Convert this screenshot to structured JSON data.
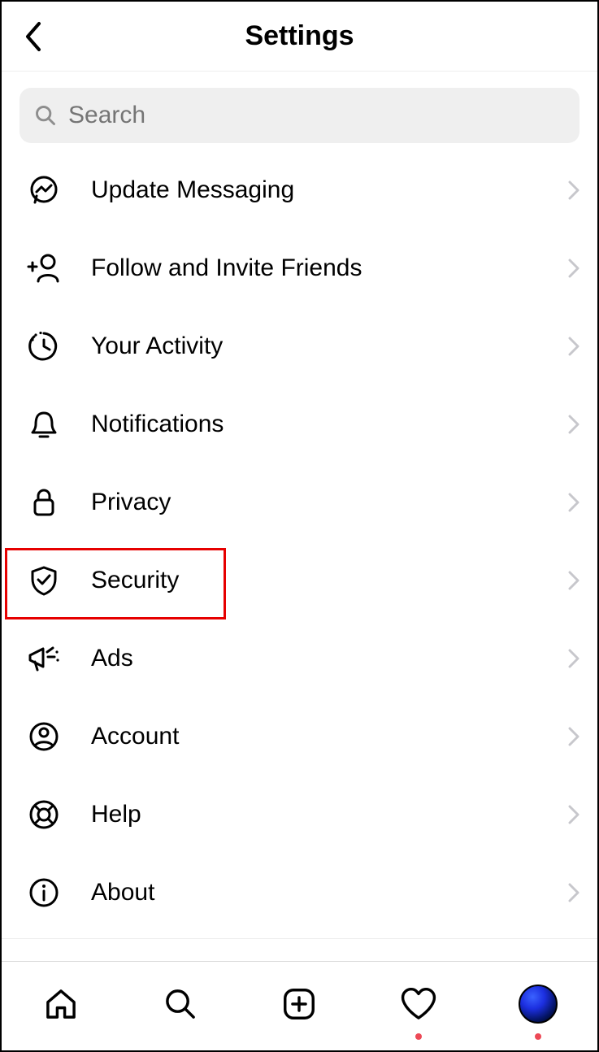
{
  "header": {
    "title": "Settings"
  },
  "search": {
    "placeholder": "Search"
  },
  "menu": {
    "update_messaging": "Update Messaging",
    "follow_invite": "Follow and Invite Friends",
    "your_activity": "Your Activity",
    "notifications": "Notifications",
    "privacy": "Privacy",
    "security": "Security",
    "ads": "Ads",
    "account": "Account",
    "help": "Help",
    "about": "About"
  }
}
